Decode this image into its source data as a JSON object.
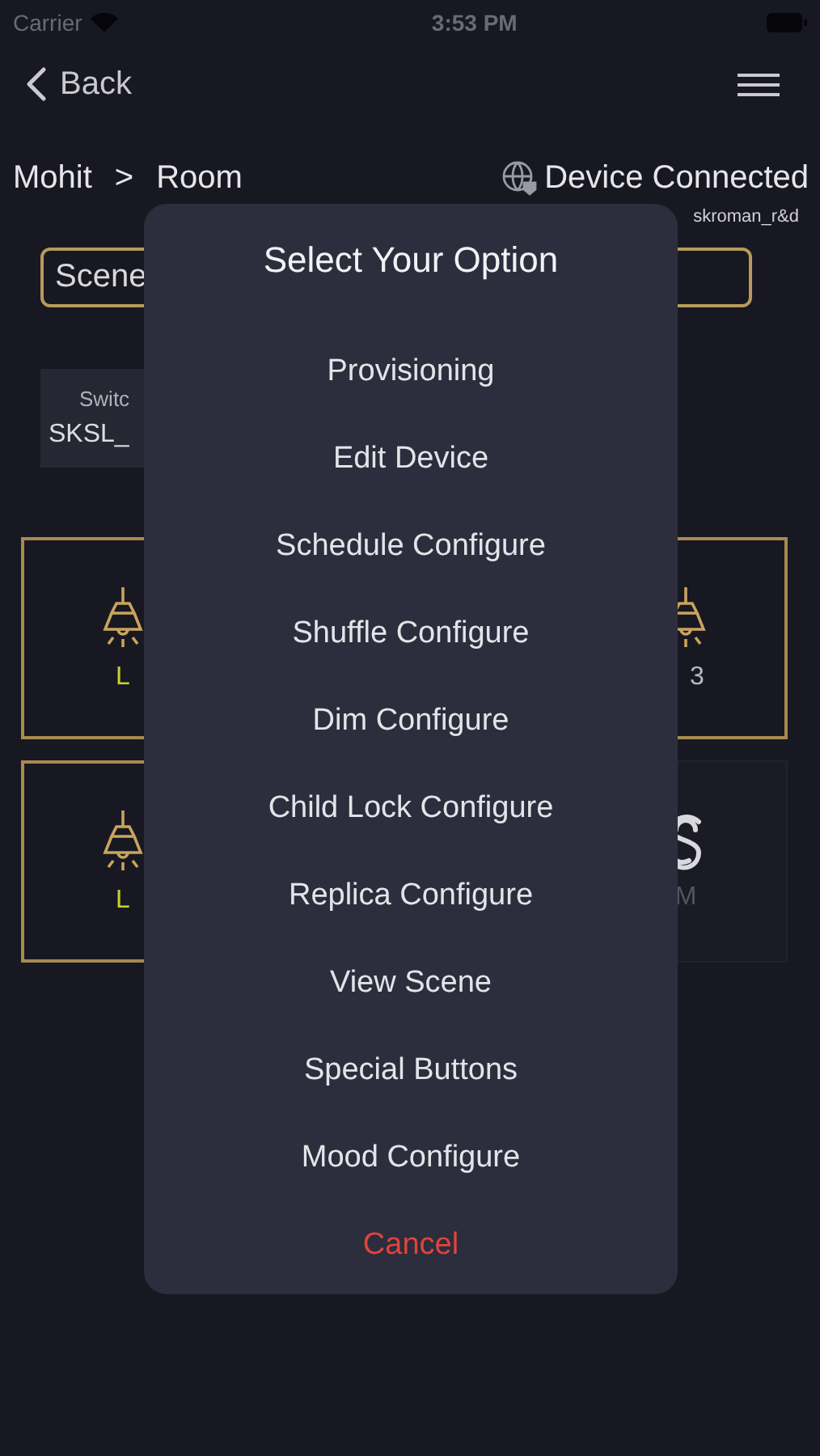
{
  "status_bar": {
    "carrier": "Carrier",
    "time": "3:53 PM"
  },
  "nav": {
    "back": "Back"
  },
  "breadcrumb": {
    "home": "Mohit",
    "separator": ">",
    "room": "Room",
    "status": "Device Connected"
  },
  "account": "skroman_r&d",
  "scene_field": {
    "value": "Scene"
  },
  "switch_card": {
    "label": "Switc",
    "name": "SKSL_"
  },
  "tiles": [
    {
      "kind": "lamp",
      "label": "L"
    },
    {
      "kind": "lamp",
      "label": "3"
    },
    {
      "kind": "lamp",
      "label": "L"
    },
    {
      "kind": "mood",
      "label": "M"
    }
  ],
  "dialog": {
    "title": "Select Your Option",
    "options": [
      {
        "label": "Provisioning",
        "kind": "option"
      },
      {
        "label": "Edit Device",
        "kind": "option"
      },
      {
        "label": "Schedule Configure",
        "kind": "option"
      },
      {
        "label": "Shuffle Configure",
        "kind": "option"
      },
      {
        "label": "Dim Configure",
        "kind": "option"
      },
      {
        "label": "Child Lock Configure",
        "kind": "option"
      },
      {
        "label": "Replica Configure",
        "kind": "option"
      },
      {
        "label": "View Scene",
        "kind": "option"
      },
      {
        "label": "Special Buttons",
        "kind": "option"
      },
      {
        "label": "Mood Configure",
        "kind": "option"
      },
      {
        "label": "Cancel",
        "kind": "cancel"
      }
    ]
  }
}
